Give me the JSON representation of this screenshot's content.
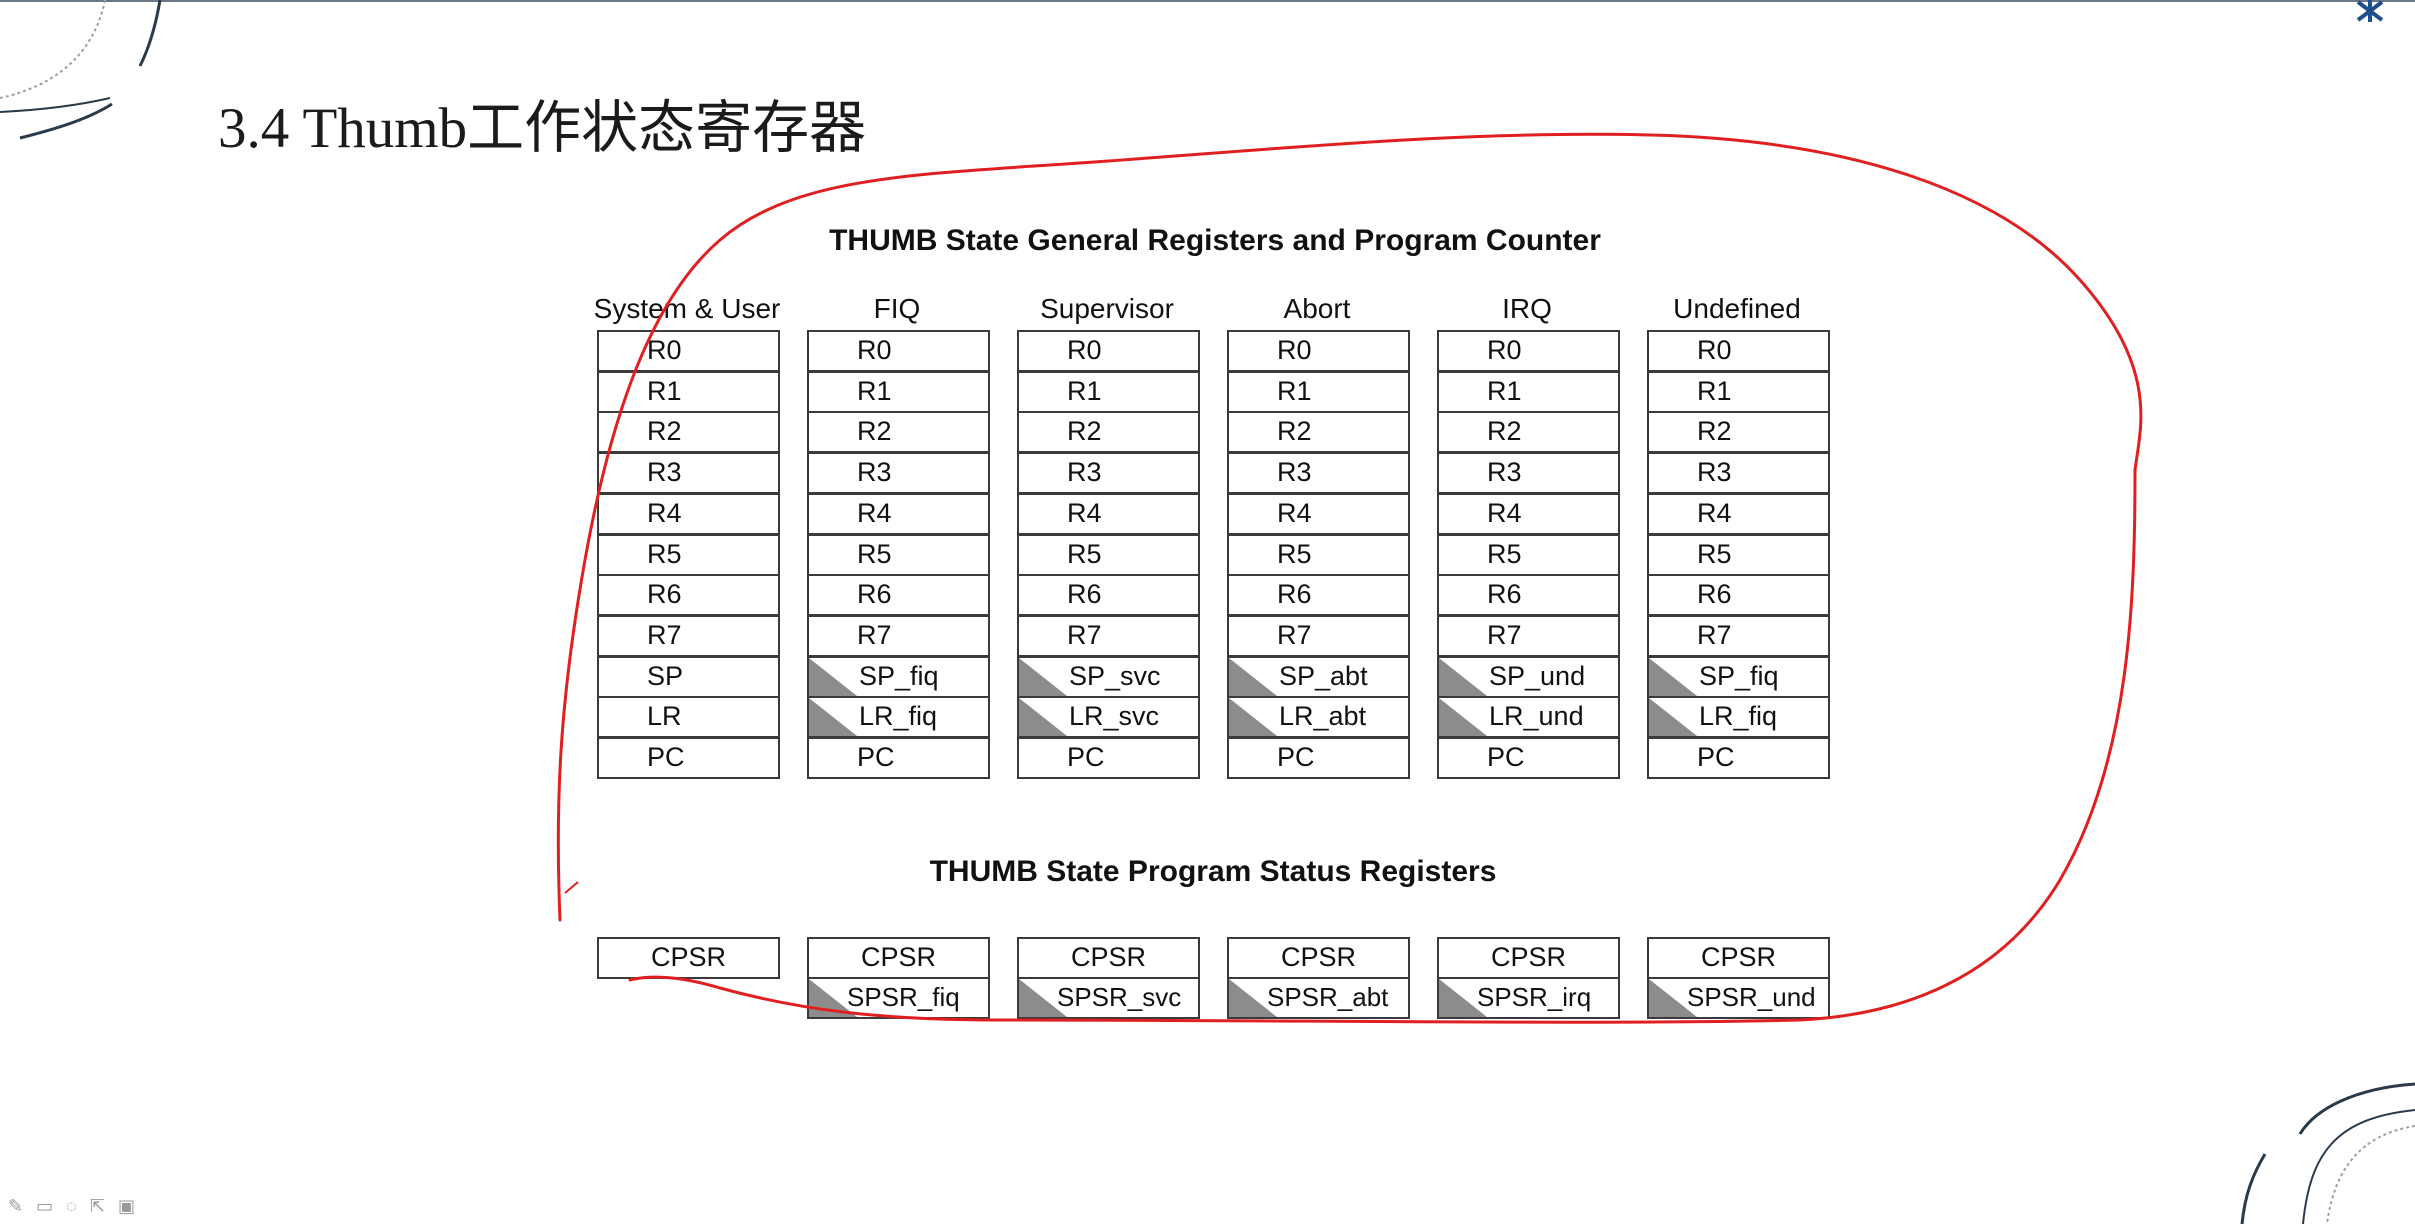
{
  "slide": {
    "title": "3.4 Thumb工作状态寄存器"
  },
  "diagram": {
    "general_heading": "THUMB State General Registers and Program Counter",
    "status_heading": "THUMB State Program Status Registers",
    "modes": [
      {
        "name": "System & User",
        "registers": [
          "R0",
          "R1",
          "R2",
          "R3",
          "R4",
          "R5",
          "R6",
          "R7",
          "SP",
          "LR",
          "PC"
        ],
        "banked": [
          false,
          false,
          false,
          false,
          false,
          false,
          false,
          false,
          false,
          false,
          false
        ],
        "status": [
          "CPSR"
        ]
      },
      {
        "name": "FIQ",
        "registers": [
          "R0",
          "R1",
          "R2",
          "R3",
          "R4",
          "R5",
          "R6",
          "R7",
          "SP_fiq",
          "LR_fiq",
          "PC"
        ],
        "banked": [
          false,
          false,
          false,
          false,
          false,
          false,
          false,
          false,
          true,
          true,
          false
        ],
        "status": [
          "CPSR",
          "SPSR_fiq"
        ]
      },
      {
        "name": "Supervisor",
        "registers": [
          "R0",
          "R1",
          "R2",
          "R3",
          "R4",
          "R5",
          "R6",
          "R7",
          "SP_svc",
          "LR_svc",
          "PC"
        ],
        "banked": [
          false,
          false,
          false,
          false,
          false,
          false,
          false,
          false,
          true,
          true,
          false
        ],
        "status": [
          "CPSR",
          "SPSR_svc"
        ]
      },
      {
        "name": "Abort",
        "registers": [
          "R0",
          "R1",
          "R2",
          "R3",
          "R4",
          "R5",
          "R6",
          "R7",
          "SP_abt",
          "LR_abt",
          "PC"
        ],
        "banked": [
          false,
          false,
          false,
          false,
          false,
          false,
          false,
          false,
          true,
          true,
          false
        ],
        "status": [
          "CPSR",
          "SPSR_abt"
        ]
      },
      {
        "name": "IRQ",
        "registers": [
          "R0",
          "R1",
          "R2",
          "R3",
          "R4",
          "R5",
          "R6",
          "R7",
          "SP_und",
          "LR_und",
          "PC"
        ],
        "banked": [
          false,
          false,
          false,
          false,
          false,
          false,
          false,
          false,
          true,
          true,
          false
        ],
        "status": [
          "CPSR",
          "SPSR_irq"
        ]
      },
      {
        "name": "Undefined",
        "registers": [
          "R0",
          "R1",
          "R2",
          "R3",
          "R4",
          "R5",
          "R6",
          "R7",
          "SP_fiq",
          "LR_fiq",
          "PC"
        ],
        "banked": [
          false,
          false,
          false,
          false,
          false,
          false,
          false,
          false,
          true,
          true,
          false
        ],
        "status": [
          "CPSR",
          "SPSR_und"
        ]
      }
    ]
  },
  "colors": {
    "annotation": "#e02020",
    "banked_marker": "#8c8c8c",
    "cell_border": "#3a3a3a",
    "decor_lines": "#2b3a4a"
  },
  "icons": [
    "pen-icon",
    "highlighter-icon",
    "eraser-icon",
    "pointer-icon",
    "menu-icon"
  ]
}
